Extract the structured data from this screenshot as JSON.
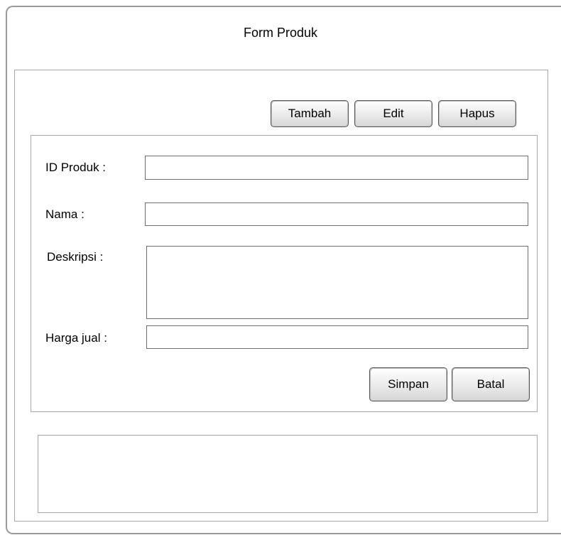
{
  "window": {
    "title": "Form Produk"
  },
  "toolbar": {
    "add_label": "Tambah",
    "edit_label": "Edit",
    "delete_label": "Hapus"
  },
  "form": {
    "id_label": "ID Produk :",
    "id_value": "",
    "name_label": "Nama :",
    "name_value": "",
    "description_label": "Deskripsi :",
    "description_value": "",
    "price_label": "Harga jual :",
    "price_value": ""
  },
  "actions": {
    "save_label": "Simpan",
    "cancel_label": "Batal"
  }
}
